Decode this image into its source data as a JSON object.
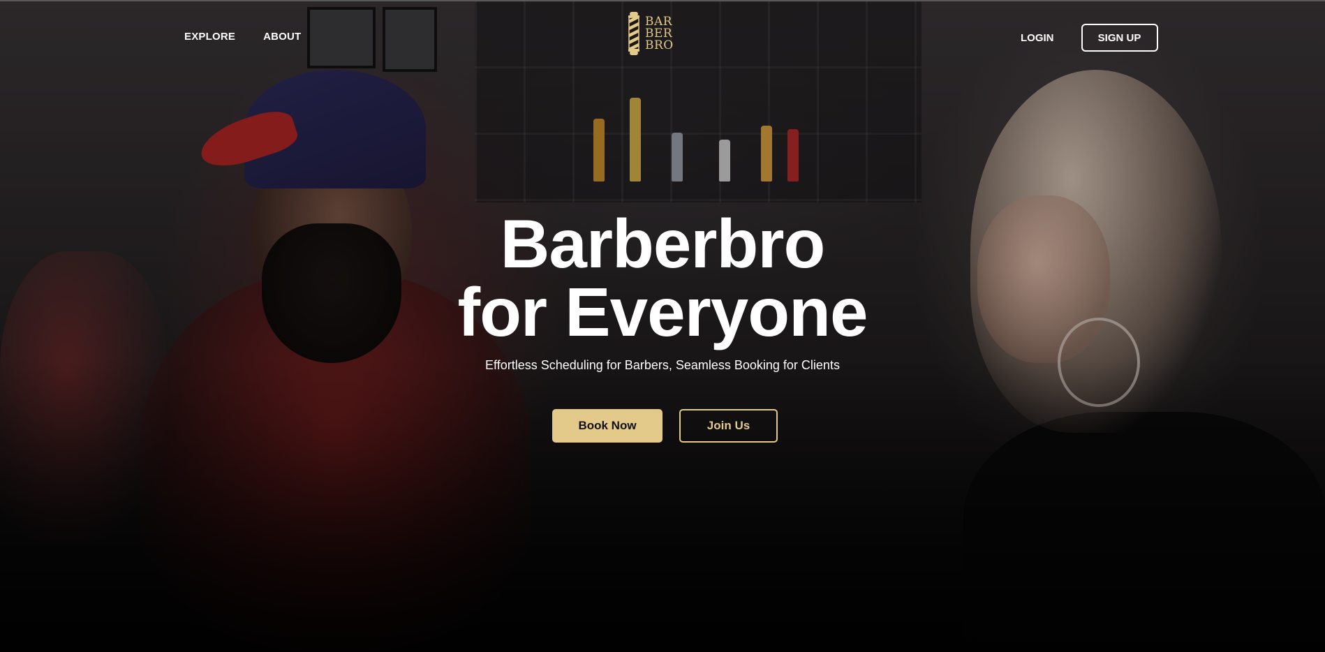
{
  "nav": {
    "explore_label": "EXPLORE",
    "about_label": "ABOUT",
    "login_label": "LOGIN",
    "signup_label": "SIGN UP"
  },
  "logo": {
    "line1": "BAR",
    "line2": "BER",
    "line3": "BRO",
    "icon": "barber-pole-icon"
  },
  "hero": {
    "headline_line1": "Barberbro",
    "headline_line2": "for Everyone",
    "subtitle": "Effortless Scheduling for Barbers, Seamless Booking for Clients",
    "book_label": "Book Now",
    "join_label": "Join Us"
  },
  "colors": {
    "accent": "#e3c98a",
    "text": "#ffffff",
    "background": "#0b0a0b"
  }
}
